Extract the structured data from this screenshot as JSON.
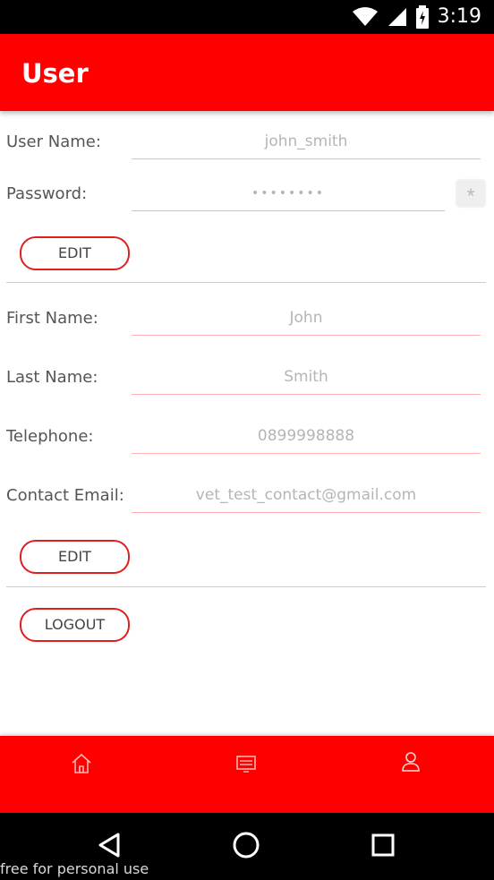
{
  "status_bar": {
    "time": "3:19"
  },
  "app_bar": {
    "title": "User"
  },
  "account": {
    "username_label": "User Name:",
    "username_value": "john_smith",
    "password_label": "Password:",
    "password_value": "••••••••",
    "password_toggle": "*",
    "edit_label": "EDIT"
  },
  "contact": {
    "first_name_label": "First Name:",
    "first_name_value": "John",
    "last_name_label": "Last Name:",
    "last_name_value": "Smith",
    "telephone_label": "Telephone:",
    "telephone_value": "0899998888",
    "email_label": "Contact Email:",
    "email_value": "vet_test_contact@gmail.com",
    "edit_label": "EDIT"
  },
  "logout_label": "LOGOUT",
  "bottom_nav": {
    "items": [
      "home-icon",
      "list-icon",
      "user-icon"
    ]
  },
  "watermark": "free for personal use",
  "colors": {
    "primary": "#ff0000",
    "underline": "#ffb0b0",
    "button_border": "#e01f1f"
  }
}
